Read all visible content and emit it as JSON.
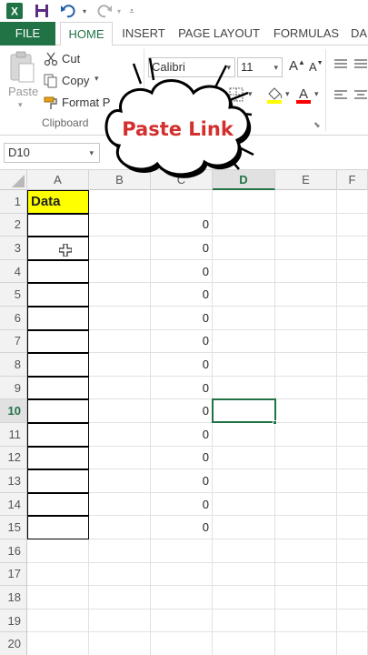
{
  "qat": {
    "icons": [
      "excel-logo-icon",
      "save-icon",
      "undo-icon",
      "redo-icon",
      "customize-qat-icon"
    ]
  },
  "tabs": [
    {
      "label": "FILE"
    },
    {
      "label": "HOME"
    },
    {
      "label": "INSERT"
    },
    {
      "label": "PAGE LAYOUT"
    },
    {
      "label": "FORMULAS"
    },
    {
      "label": "DA"
    }
  ],
  "ribbon": {
    "paste_label": "Paste",
    "cut_label": "Cut",
    "copy_label": "Copy",
    "format_painter_label": "Format P",
    "clipboard_group": "Clipboard",
    "font_name": "Calibri",
    "font_size": "11",
    "grow_font": "A",
    "shrink_font": "A",
    "fill_color": "#ffff00",
    "font_color": "#ff0000"
  },
  "formula_bar": {
    "name_box": "D10"
  },
  "grid": {
    "columns": [
      "A",
      "B",
      "C",
      "D",
      "E",
      "F"
    ],
    "selected_column": "D",
    "selected_row": "10",
    "header_value": "Data",
    "rows": [
      {
        "num": "1",
        "c": ""
      },
      {
        "num": "2",
        "c": "0"
      },
      {
        "num": "3",
        "c": "0"
      },
      {
        "num": "4",
        "c": "0"
      },
      {
        "num": "5",
        "c": "0"
      },
      {
        "num": "6",
        "c": "0"
      },
      {
        "num": "7",
        "c": "0"
      },
      {
        "num": "8",
        "c": "0"
      },
      {
        "num": "9",
        "c": "0"
      },
      {
        "num": "10",
        "c": "0"
      },
      {
        "num": "11",
        "c": "0"
      },
      {
        "num": "12",
        "c": "0"
      },
      {
        "num": "13",
        "c": "0"
      },
      {
        "num": "14",
        "c": "0"
      },
      {
        "num": "15",
        "c": "0"
      },
      {
        "num": "16",
        "c": ""
      },
      {
        "num": "17",
        "c": ""
      },
      {
        "num": "18",
        "c": ""
      },
      {
        "num": "19",
        "c": ""
      },
      {
        "num": "20",
        "c": ""
      }
    ]
  },
  "callout": {
    "text": "Paste Link"
  }
}
